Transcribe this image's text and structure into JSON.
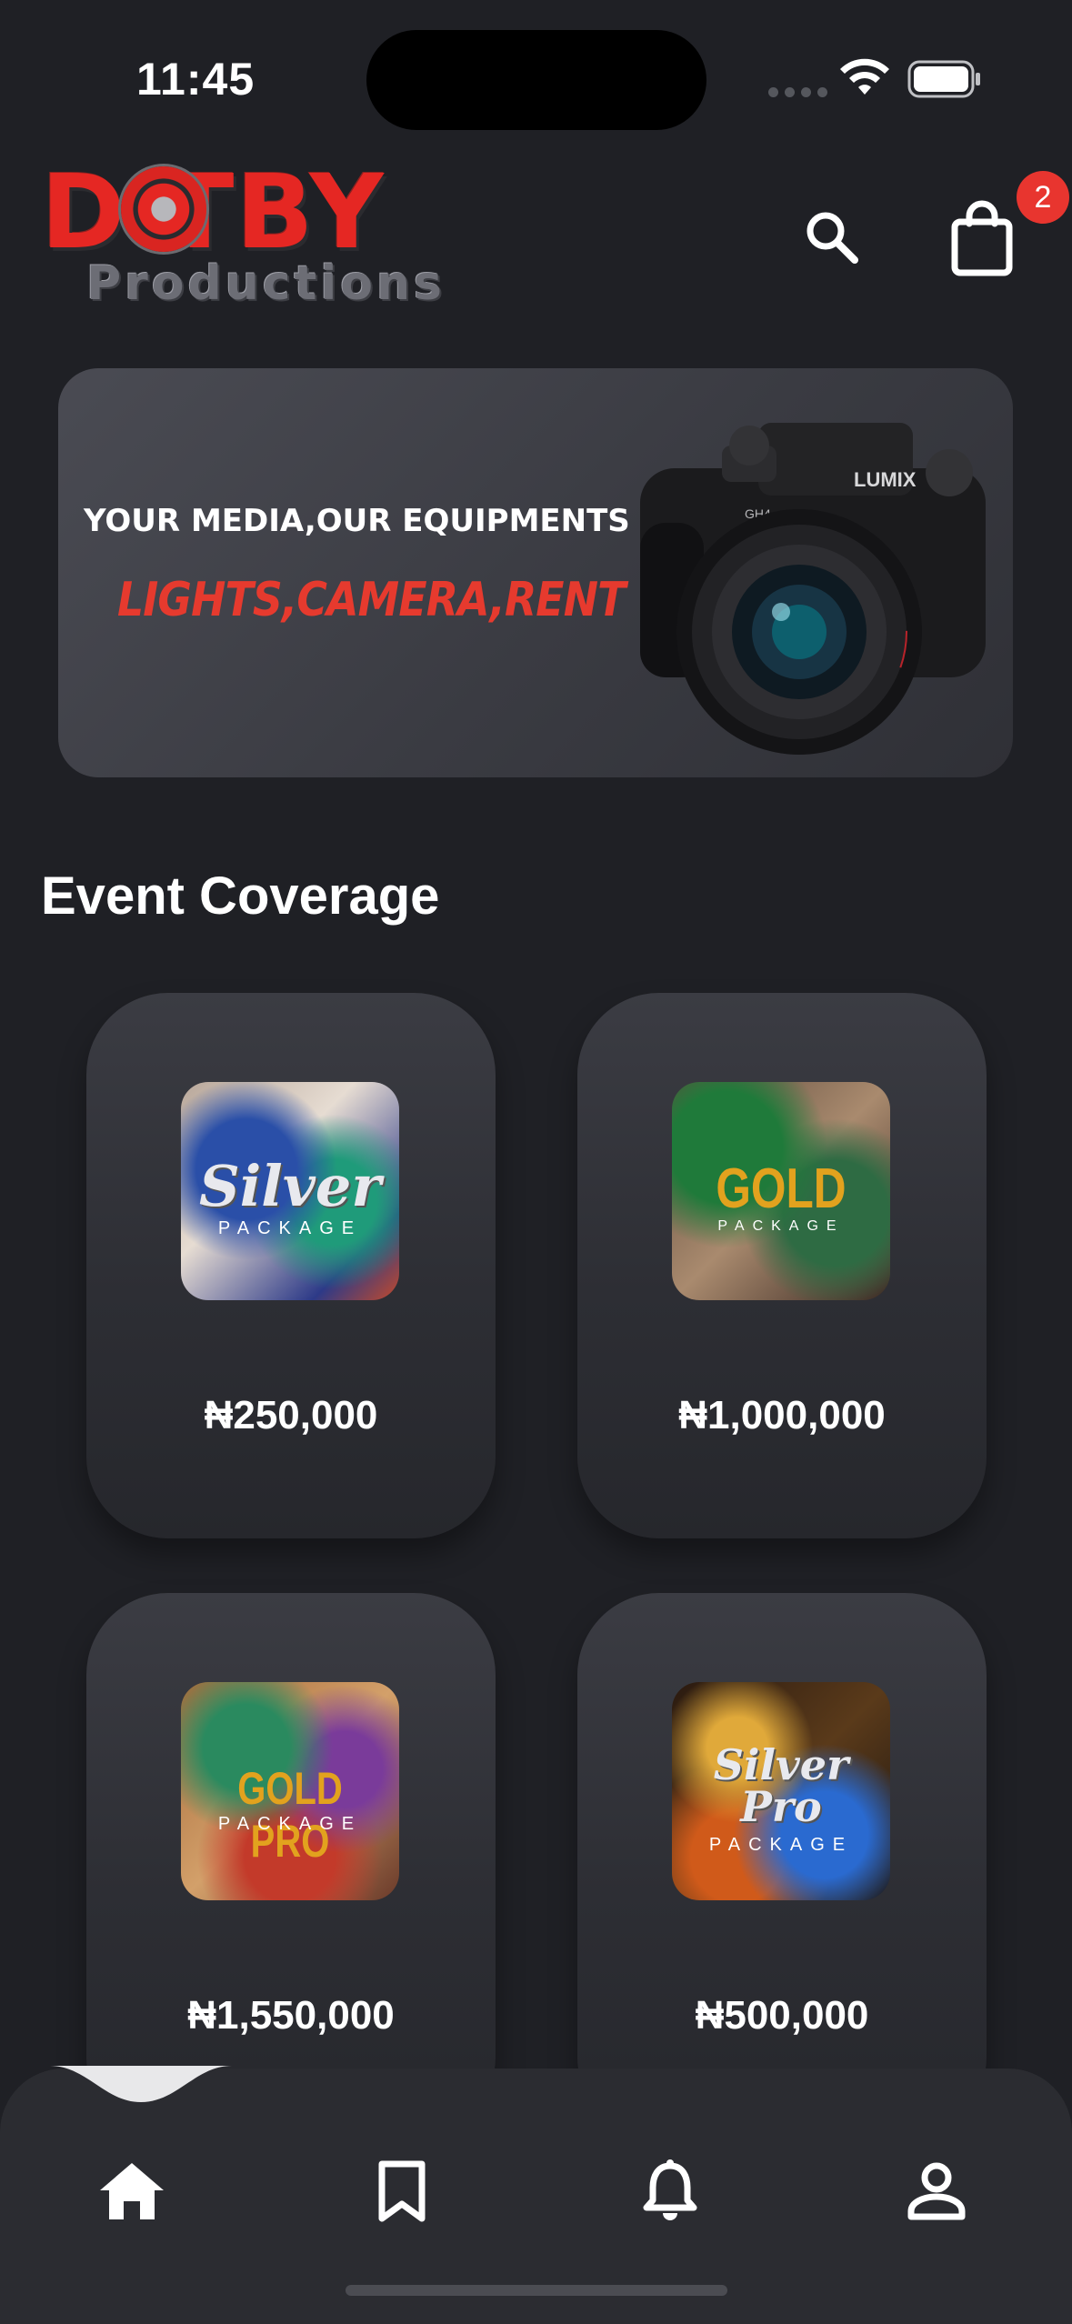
{
  "status_bar": {
    "time": "11:45"
  },
  "header": {
    "logo_top": "D  TBY",
    "logo_bottom": "Productions",
    "cart_badge": "2",
    "icons": {
      "search": "search-icon",
      "cart": "shopping-bag-icon"
    }
  },
  "banner": {
    "line1": "YOUR MEDIA,OUR EQUIPMENTS",
    "line2": "LIGHTS,CAMERA,RENT",
    "image": "camera-image"
  },
  "section": {
    "title": "Event Coverage"
  },
  "packages": [
    {
      "thumb_main": "Silver",
      "thumb_sub": "PACKAGE",
      "price": "₦250,000"
    },
    {
      "thumb_main": "GOLD",
      "thumb_sub": "PACKAGE",
      "price": "₦1,000,000"
    },
    {
      "thumb_main": "GOLD PRO",
      "thumb_sub": "PACKAGE",
      "price": "₦1,550,000"
    },
    {
      "thumb_main": "Silver Pro",
      "thumb_sub": "PACKAGE",
      "price": "₦500,000"
    }
  ],
  "bottom_nav": {
    "items": [
      "home-icon",
      "bookmark-icon",
      "bell-icon",
      "profile-icon"
    ],
    "active": "home-icon"
  },
  "colors": {
    "background": "#1f2025",
    "accent_red": "#e63a2e",
    "badge": "#e8352f",
    "gold": "#e2a21e"
  }
}
